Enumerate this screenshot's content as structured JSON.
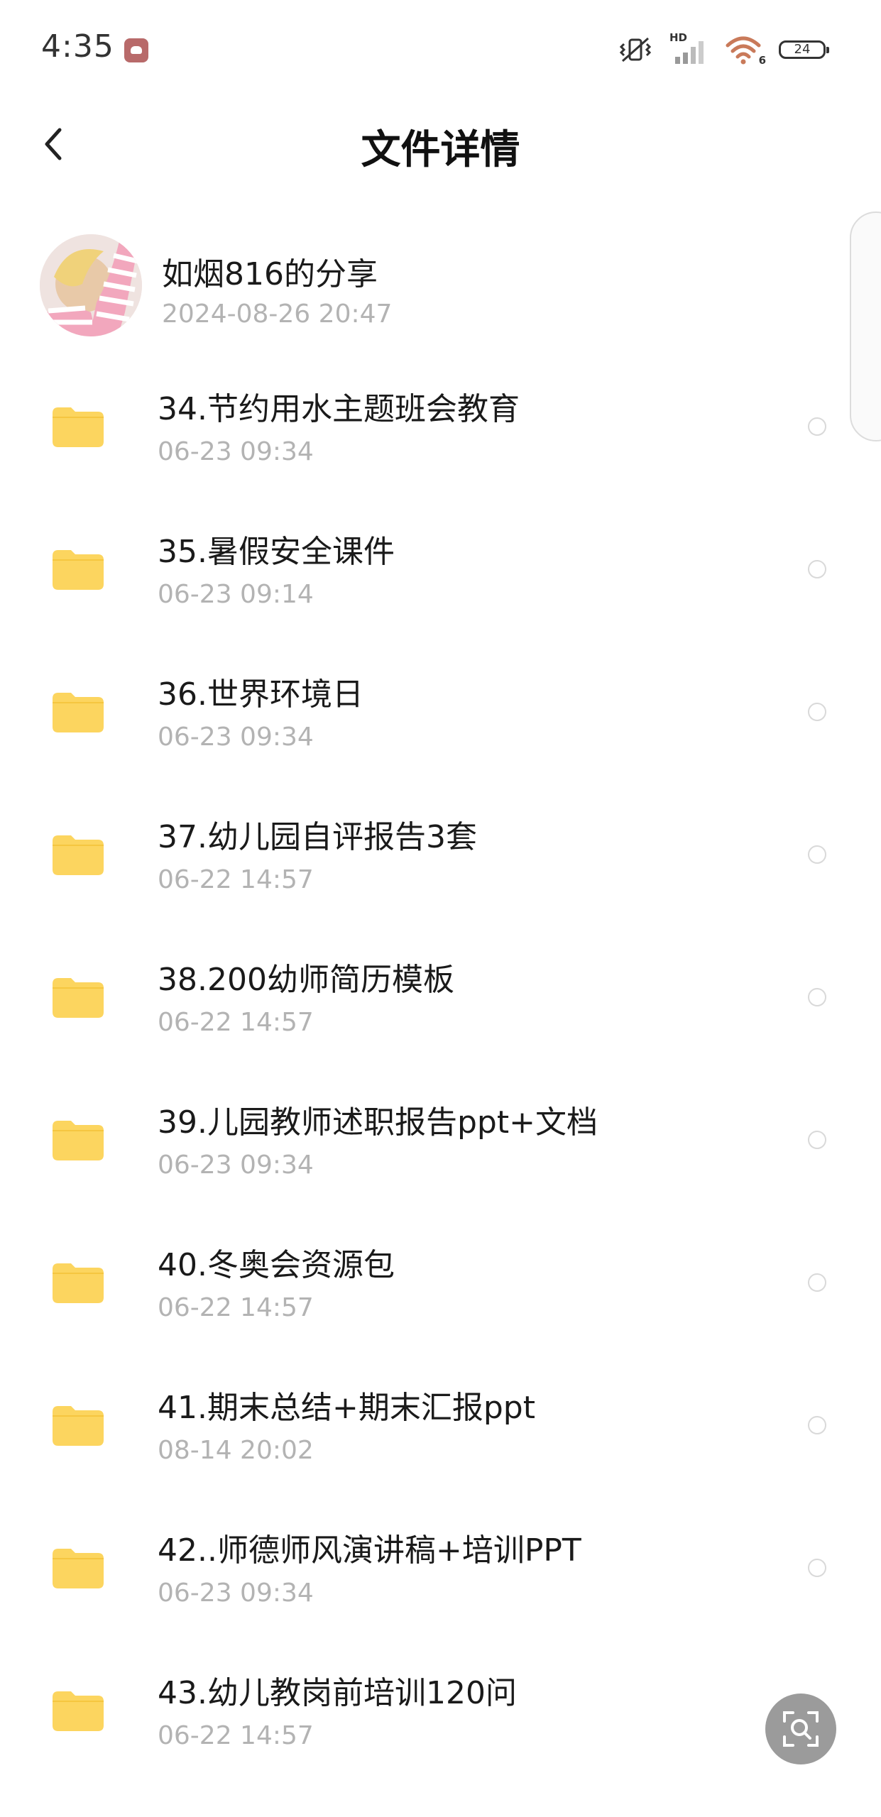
{
  "status_bar": {
    "time": "4:35",
    "network_label": "HD",
    "wifi_badge": "6",
    "battery_level": "24",
    "icons": [
      "app-notification-icon",
      "vibrate-icon",
      "signal-icon",
      "wifi-icon",
      "battery-icon"
    ]
  },
  "header": {
    "title": "文件详情",
    "back_icon": "chevron-left-icon"
  },
  "sharer": {
    "name": "如烟816的分享",
    "datetime": "2024-08-26  20:47"
  },
  "files": [
    {
      "name": "34.节约用水主题班会教育",
      "time": "06-23  09:34"
    },
    {
      "name": "35.暑假安全课件",
      "time": "06-23  09:14"
    },
    {
      "name": "36.世界环境日",
      "time": "06-23  09:34"
    },
    {
      "name": "37.幼儿园自评报告3套",
      "time": "06-22  14:57"
    },
    {
      "name": "38.200幼师简历模板",
      "time": "06-22  14:57"
    },
    {
      "name": "39.儿园教师述职报告ppt+文档",
      "time": "06-23  09:34"
    },
    {
      "name": "40.冬奥会资源包",
      "time": "06-22  14:57"
    },
    {
      "name": "41.期末总结+期末汇报ppt",
      "time": "08-14  20:02"
    },
    {
      "name": "42..师德师风演讲稿+培训PPT",
      "time": "06-23  09:34"
    },
    {
      "name": "43.幼儿教岗前培训120问",
      "time": "06-22  14:57"
    }
  ],
  "colors": {
    "folder": "#fcd55f",
    "secondary_text": "#b3b3b3",
    "scan_button": "#9b9b9b"
  },
  "floating_button_icon": "scan-search-icon"
}
